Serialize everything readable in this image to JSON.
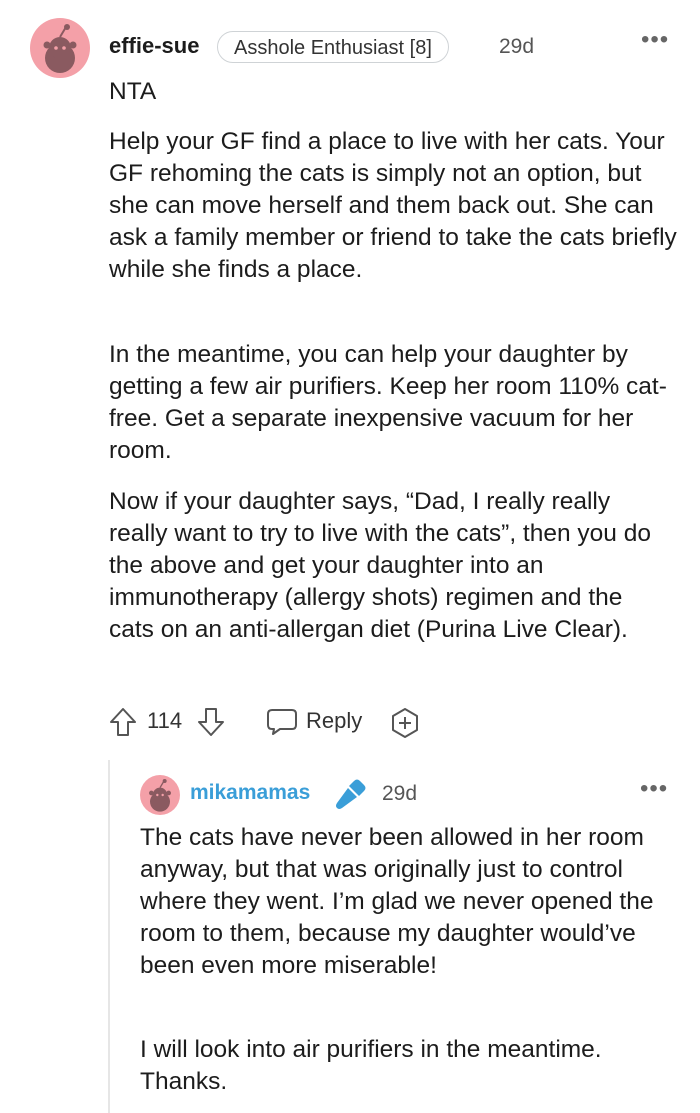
{
  "comment": {
    "username": "effie-sue",
    "flair": "Asshole Enthusiast [8]",
    "time": "29d",
    "more_label": "•••",
    "verdict": "NTA",
    "paragraphs": [
      "Help your GF find a place to live with her cats. Your GF rehoming the cats is simply not an option, but she can move herself and them back out. She can ask a family member or friend to take the cats briefly while she finds a place.",
      "In the meantime, you can help your daughter by getting a few air purifiers. Keep her room 110% cat-free. Get a separate inexpensive vacuum for her room.",
      "Now if your daughter says, “Dad, I really really really want to try to live with the cats”, then you do the above and get your daughter into an immunotherapy (allergy shots) regimen and the cats on an anti-allergan diet (Purina Live Clear)."
    ],
    "score": "114",
    "reply_label": "Reply"
  },
  "reply": {
    "username": "mikamamas",
    "time": "29d",
    "more_label": "•••",
    "paragraphs": [
      "The cats have never been allowed in her room anyway, but that was originally just to control where they went. I’m glad we never opened the room to them, because my daughter would’ve been even more miserable!",
      "I will look into air purifiers in the meantime. Thanks."
    ]
  },
  "icons": {
    "avatar": "snoo-avatar-icon",
    "upvote": "upvote-arrow-icon",
    "downvote": "downvote-arrow-icon",
    "reply": "speech-bubble-icon",
    "award": "award-plus-icon",
    "op_badge": "microphone-icon"
  },
  "colors": {
    "avatar_bg": "#f4a0a8",
    "reply_username": "#3a9ed8",
    "mic": "#3a9ed8",
    "text": "#1c1c1c"
  }
}
